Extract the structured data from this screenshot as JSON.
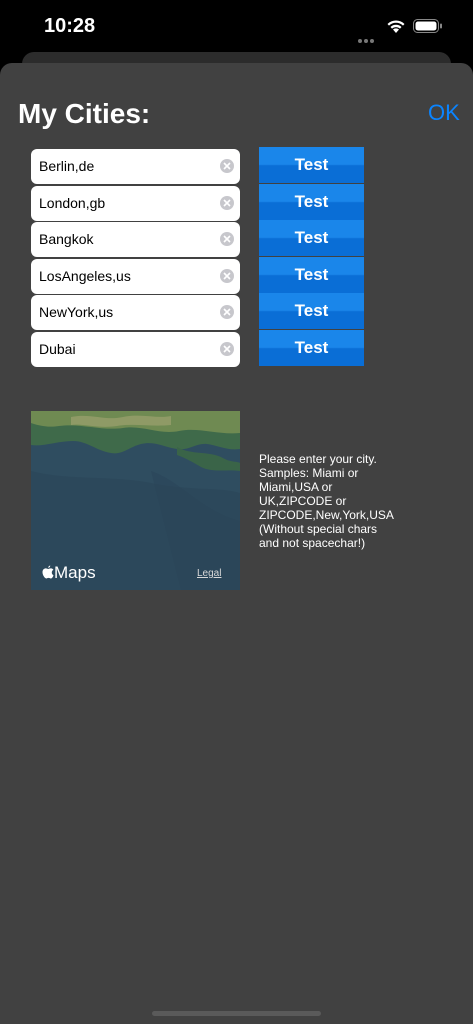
{
  "status_bar": {
    "time": "10:28"
  },
  "header": {
    "title": "My Cities:",
    "ok_label": "OK"
  },
  "cities": [
    {
      "value": "Berlin,de",
      "button": "Test"
    },
    {
      "value": "London,gb",
      "button": "Test"
    },
    {
      "value": "Bangkok",
      "button": "Test"
    },
    {
      "value": "LosAngeles,us",
      "button": "Test"
    },
    {
      "value": "NewYork,us",
      "button": "Test"
    },
    {
      "value": "Dubai",
      "button": "Test"
    }
  ],
  "map": {
    "brand": "Maps",
    "legal": "Legal"
  },
  "help_text": "Please enter your city.\nSamples: Miami or\nMiami,USA or\nUK,ZIPCODE or\nZIPCODE,New,York,USA\n(Without special chars\nand not spacechar!)",
  "colors": {
    "accent": "#0a84ff",
    "button": "#1a86ea",
    "background": "#414141"
  }
}
